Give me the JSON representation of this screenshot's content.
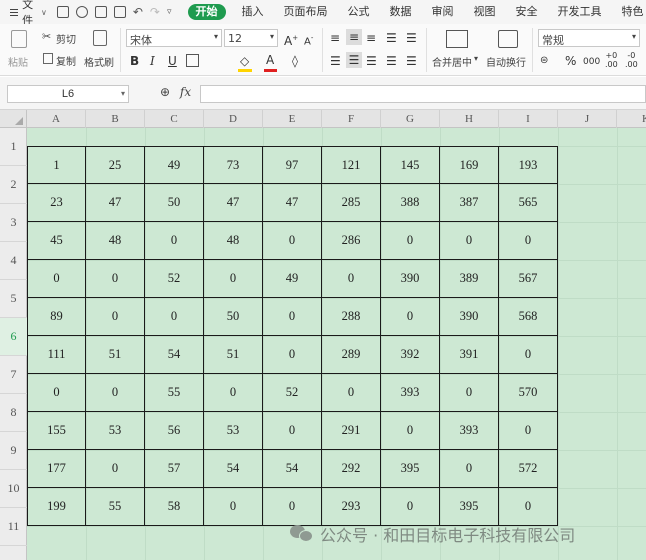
{
  "menubar": {
    "file_label": "文件",
    "tabs": [
      {
        "label": "开始",
        "active": true
      },
      {
        "label": "插入"
      },
      {
        "label": "页面布局"
      },
      {
        "label": "公式"
      },
      {
        "label": "数据"
      },
      {
        "label": "审阅"
      },
      {
        "label": "视图"
      },
      {
        "label": "安全"
      },
      {
        "label": "开发工具"
      },
      {
        "label": "特色"
      }
    ]
  },
  "ribbon": {
    "paste_label": "粘贴",
    "cut_label": "剪切",
    "copy_label": "复制",
    "format_painter_label": "格式刷",
    "font_name": "宋体",
    "font_size": "12",
    "merge_center_label": "合并居中",
    "wrap_text_label": "自动换行",
    "number_format": "常规"
  },
  "formula_bar": {
    "name_box": "L6",
    "fx_label": "fx",
    "formula": ""
  },
  "sheet": {
    "columns": [
      "A",
      "B",
      "C",
      "D",
      "E",
      "F",
      "G",
      "H",
      "I",
      "J",
      "K"
    ],
    "rows": [
      "1",
      "2",
      "3",
      "4",
      "5",
      "6",
      "7",
      "8",
      "9",
      "10",
      "11"
    ],
    "selected_row": "6",
    "data": [
      [
        "1",
        "25",
        "49",
        "73",
        "97",
        "121",
        "145",
        "169",
        "193"
      ],
      [
        "23",
        "47",
        "50",
        "47",
        "47",
        "285",
        "388",
        "387",
        "565"
      ],
      [
        "45",
        "48",
        "0",
        "48",
        "0",
        "286",
        "0",
        "0",
        "0"
      ],
      [
        "0",
        "0",
        "52",
        "0",
        "49",
        "0",
        "390",
        "389",
        "567"
      ],
      [
        "89",
        "0",
        "0",
        "50",
        "0",
        "288",
        "0",
        "390",
        "568"
      ],
      [
        "111",
        "51",
        "54",
        "51",
        "0",
        "289",
        "392",
        "391",
        "0"
      ],
      [
        "0",
        "0",
        "55",
        "0",
        "52",
        "0",
        "393",
        "0",
        "570"
      ],
      [
        "155",
        "53",
        "56",
        "53",
        "0",
        "291",
        "0",
        "393",
        "0"
      ],
      [
        "177",
        "0",
        "57",
        "54",
        "54",
        "292",
        "395",
        "0",
        "572"
      ],
      [
        "199",
        "55",
        "58",
        "0",
        "0",
        "293",
        "0",
        "395",
        "0"
      ]
    ]
  },
  "watermark": "公众号 · 和田目标电子科技有限公司",
  "colors": {
    "accent": "#1f9b4f",
    "sheet_background": "#cde8d3"
  }
}
